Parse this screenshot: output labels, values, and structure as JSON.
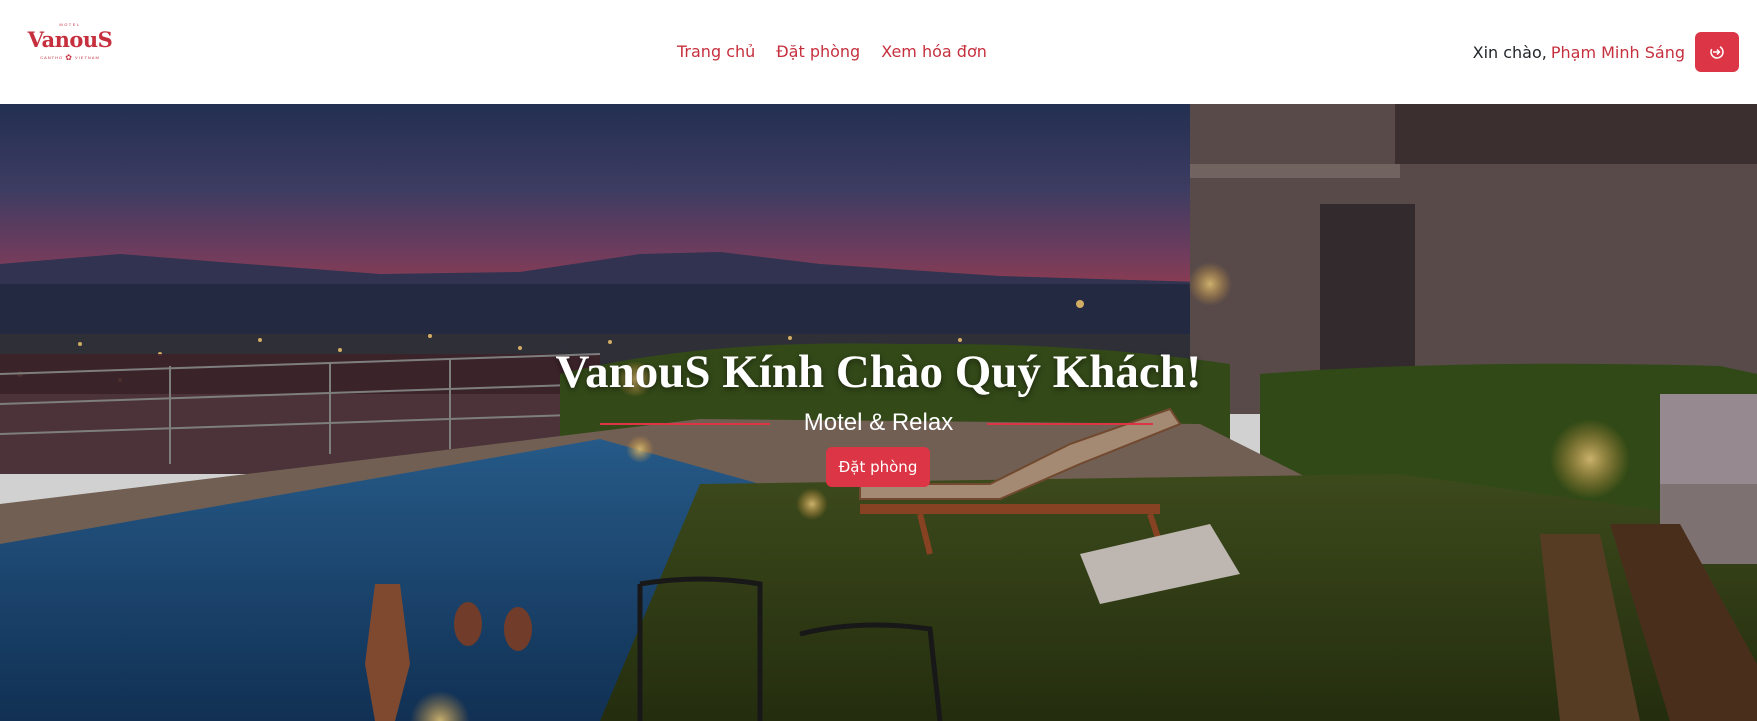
{
  "brand": {
    "top_text": "MOTEL",
    "name": "VanouS",
    "bottom_left": "CANTHO",
    "bottom_right": "VIETNAM",
    "color": "#c6303e"
  },
  "nav": {
    "items": [
      {
        "label": "Trang chủ"
      },
      {
        "label": "Đặt phòng"
      },
      {
        "label": "Xem hóa đơn"
      }
    ]
  },
  "user": {
    "greeting": "Xin chào,",
    "name": "Phạm Minh Sáng",
    "logout_icon": "logout-icon"
  },
  "hero": {
    "title": "VanouS Kính Chào Quý Khách!",
    "subtitle": "Motel & Relax",
    "cta_label": "Đặt phòng",
    "background": "night-pool-terrace-photo"
  },
  "colors": {
    "accent": "#dc3545",
    "text_dark": "#212529"
  }
}
